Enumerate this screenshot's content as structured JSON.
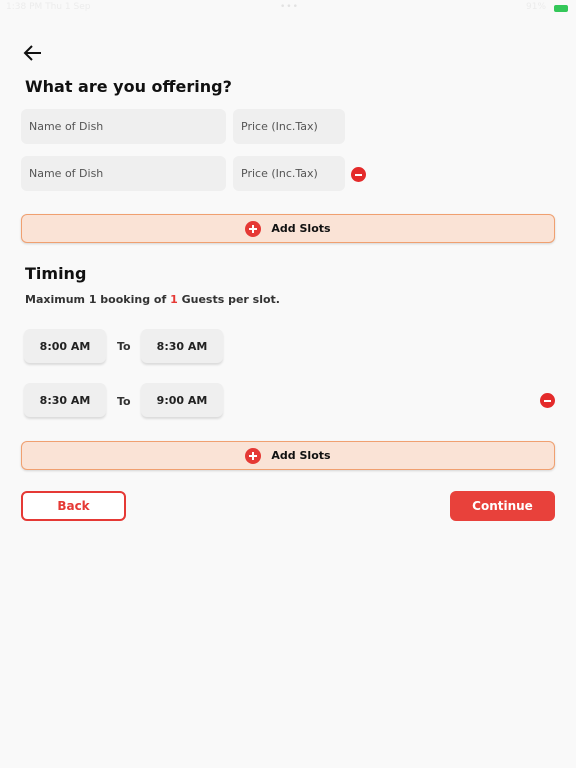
{
  "status_bar": {
    "time": "1:38 PM  Thu 1 Sep",
    "battery": "91%"
  },
  "offering": {
    "title": "What are you offering?",
    "rows": [
      {
        "dish_placeholder": "Name of Dish",
        "price_placeholder": "Price (Inc.Tax)",
        "removable": false
      },
      {
        "dish_placeholder": "Name of Dish",
        "price_placeholder": "Price (Inc.Tax)",
        "removable": true
      }
    ],
    "add_label": "Add Slots"
  },
  "timing": {
    "title": "Timing",
    "subtitle_pre": "Maximum 1 booking of ",
    "guests": "1",
    "subtitle_post": " Guests per slot.",
    "slots": [
      {
        "from": "8:00 AM",
        "to_label": "To",
        "to": "8:30 AM",
        "removable": false
      },
      {
        "from": "8:30 AM",
        "to_label": "To",
        "to": "9:00 AM",
        "removable": true
      }
    ],
    "add_label": "Add Slots"
  },
  "actions": {
    "back": "Back",
    "continue": "Continue"
  },
  "colors": {
    "accent": "#e53935",
    "add_bg": "#fae3d6",
    "input_bg": "#efefef"
  }
}
